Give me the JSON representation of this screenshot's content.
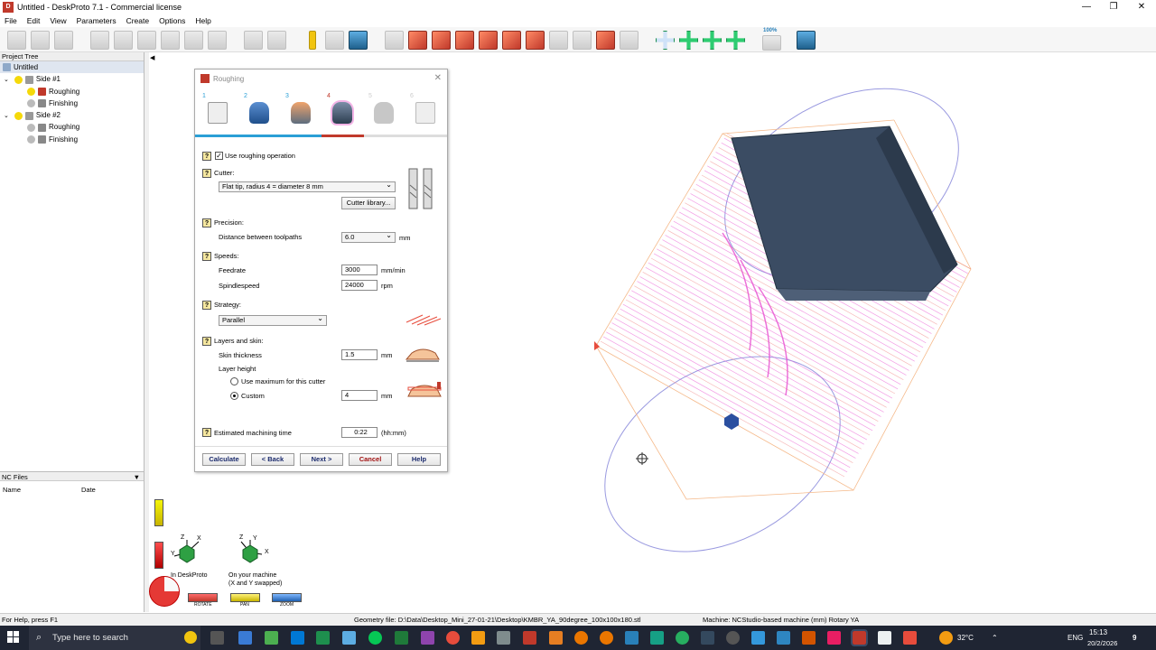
{
  "window": {
    "title": "Untitled - DeskProto 7.1 - Commercial license",
    "controls": {
      "minimize": "—",
      "maximize": "❐",
      "close": "✕"
    }
  },
  "menu": [
    "File",
    "Edit",
    "View",
    "Parameters",
    "Create",
    "Options",
    "Help"
  ],
  "toolbar": {
    "zoom_label": "100%"
  },
  "project_tree": {
    "header": "Project Tree",
    "root": "Untitled",
    "items": [
      {
        "label": "Side #1",
        "level": 1
      },
      {
        "label": "Roughing",
        "level": 2
      },
      {
        "label": "Finishing",
        "level": 2
      },
      {
        "label": "Side #2",
        "level": 1
      },
      {
        "label": "Roughing",
        "level": 2
      },
      {
        "label": "Finishing",
        "level": 2
      }
    ]
  },
  "nc_files": {
    "header": "NC Files",
    "columns": [
      "Name",
      "Date"
    ]
  },
  "dialog": {
    "title": "Roughing",
    "close": "✕",
    "steps": [
      "1",
      "2",
      "3",
      "4",
      "5",
      "6"
    ],
    "use_roughing": {
      "label": "Use roughing operation",
      "checked": true
    },
    "cutter": {
      "label": "Cutter:",
      "selected": "Flat tip, radius 4 = diameter 8 mm",
      "library_button": "Cutter library..."
    },
    "precision": {
      "label": "Precision:",
      "distance_label": "Distance between toolpaths",
      "distance_value": "6.0",
      "unit": "mm"
    },
    "speeds": {
      "label": "Speeds:",
      "feedrate_label": "Feedrate",
      "feedrate_value": "3000",
      "feedrate_unit": "mm/min",
      "spindle_label": "Spindlespeed",
      "spindle_value": "24000",
      "spindle_unit": "rpm"
    },
    "strategy": {
      "label": "Strategy:",
      "selected": "Parallel"
    },
    "layers": {
      "label": "Layers and skin:",
      "skin_label": "Skin thickness",
      "skin_value": "1.5",
      "skin_unit": "mm",
      "layer_height_label": "Layer height",
      "opt_max": "Use maximum for this cutter",
      "opt_custom": "Custom",
      "custom_value": "4",
      "custom_unit": "mm",
      "selected_option": "Custom"
    },
    "time": {
      "label": "Estimated machining time",
      "value": "0:22",
      "unit": "(hh:mm)"
    },
    "buttons": {
      "calculate": "Calculate",
      "back": "< Back",
      "next": "Next >",
      "cancel": "Cancel",
      "help": "Help"
    },
    "help_glyph": "?"
  },
  "orientation": {
    "deskproto_label": "In DeskProto",
    "machine_label": "On your machine",
    "machine_sub": "(X and Y swapped)",
    "axes_left": {
      "z": "Z",
      "x": "X",
      "y": "Y"
    },
    "axes_right": {
      "z": "Z",
      "y": "Y",
      "x": "X"
    }
  },
  "view_tools": {
    "rotate": "ROTATE",
    "pan": "PAN",
    "zoom": "ZOOM"
  },
  "status": {
    "help": "For Help, press F1",
    "geometry": "Geometry file: D:\\Data\\Desktop_Mini_27-01-21\\Desktop\\KMBR_YA_90degree_100x100x180.stl",
    "machine": "Machine: NCStudio-based machine (mm) Rotary YA"
  },
  "taskbar": {
    "search_placeholder": "Type here to search",
    "temperature": "32°C",
    "language": "ENG",
    "time": "15:13",
    "date": "20/2/2026",
    "notifications": "9"
  },
  "colors": {
    "accent_blue": "#2a9fd6",
    "accent_red": "#c0392b",
    "toolpath_pink": "#e84fd0",
    "model_dark": "#3b4c63"
  }
}
